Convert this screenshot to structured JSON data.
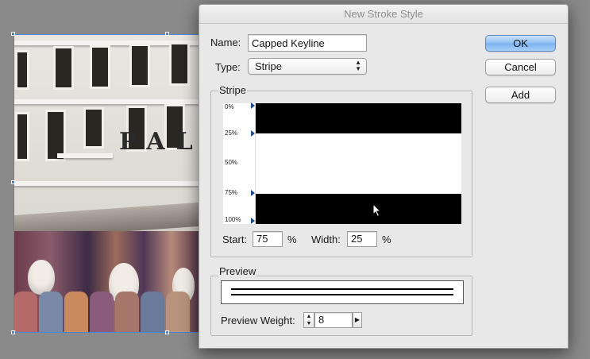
{
  "dialog": {
    "title": "New Stroke Style",
    "name_label": "Name:",
    "name_value": "Capped Keyline",
    "type_label": "Type:",
    "type_value": "Stripe",
    "buttons": {
      "ok": "OK",
      "cancel": "Cancel",
      "add": "Add"
    }
  },
  "stripe_group": {
    "title": "Stripe",
    "ruler_ticks": [
      "0%",
      "25%",
      "50%",
      "75%",
      "100%"
    ],
    "stripes": [
      {
        "start": 0,
        "width": 25
      },
      {
        "start": 75,
        "width": 25
      }
    ],
    "start_label": "Start:",
    "start_value": "75",
    "start_unit": "%",
    "width_label": "Width:",
    "width_value": "25",
    "width_unit": "%"
  },
  "preview_group": {
    "title": "Preview",
    "weight_label": "Preview Weight:",
    "weight_value": "8"
  },
  "canvas": {
    "sign_text": "PAL"
  },
  "colors": {
    "default_button": "#79b2ef",
    "stripe": "#000000",
    "selection": "#4a86d6"
  }
}
